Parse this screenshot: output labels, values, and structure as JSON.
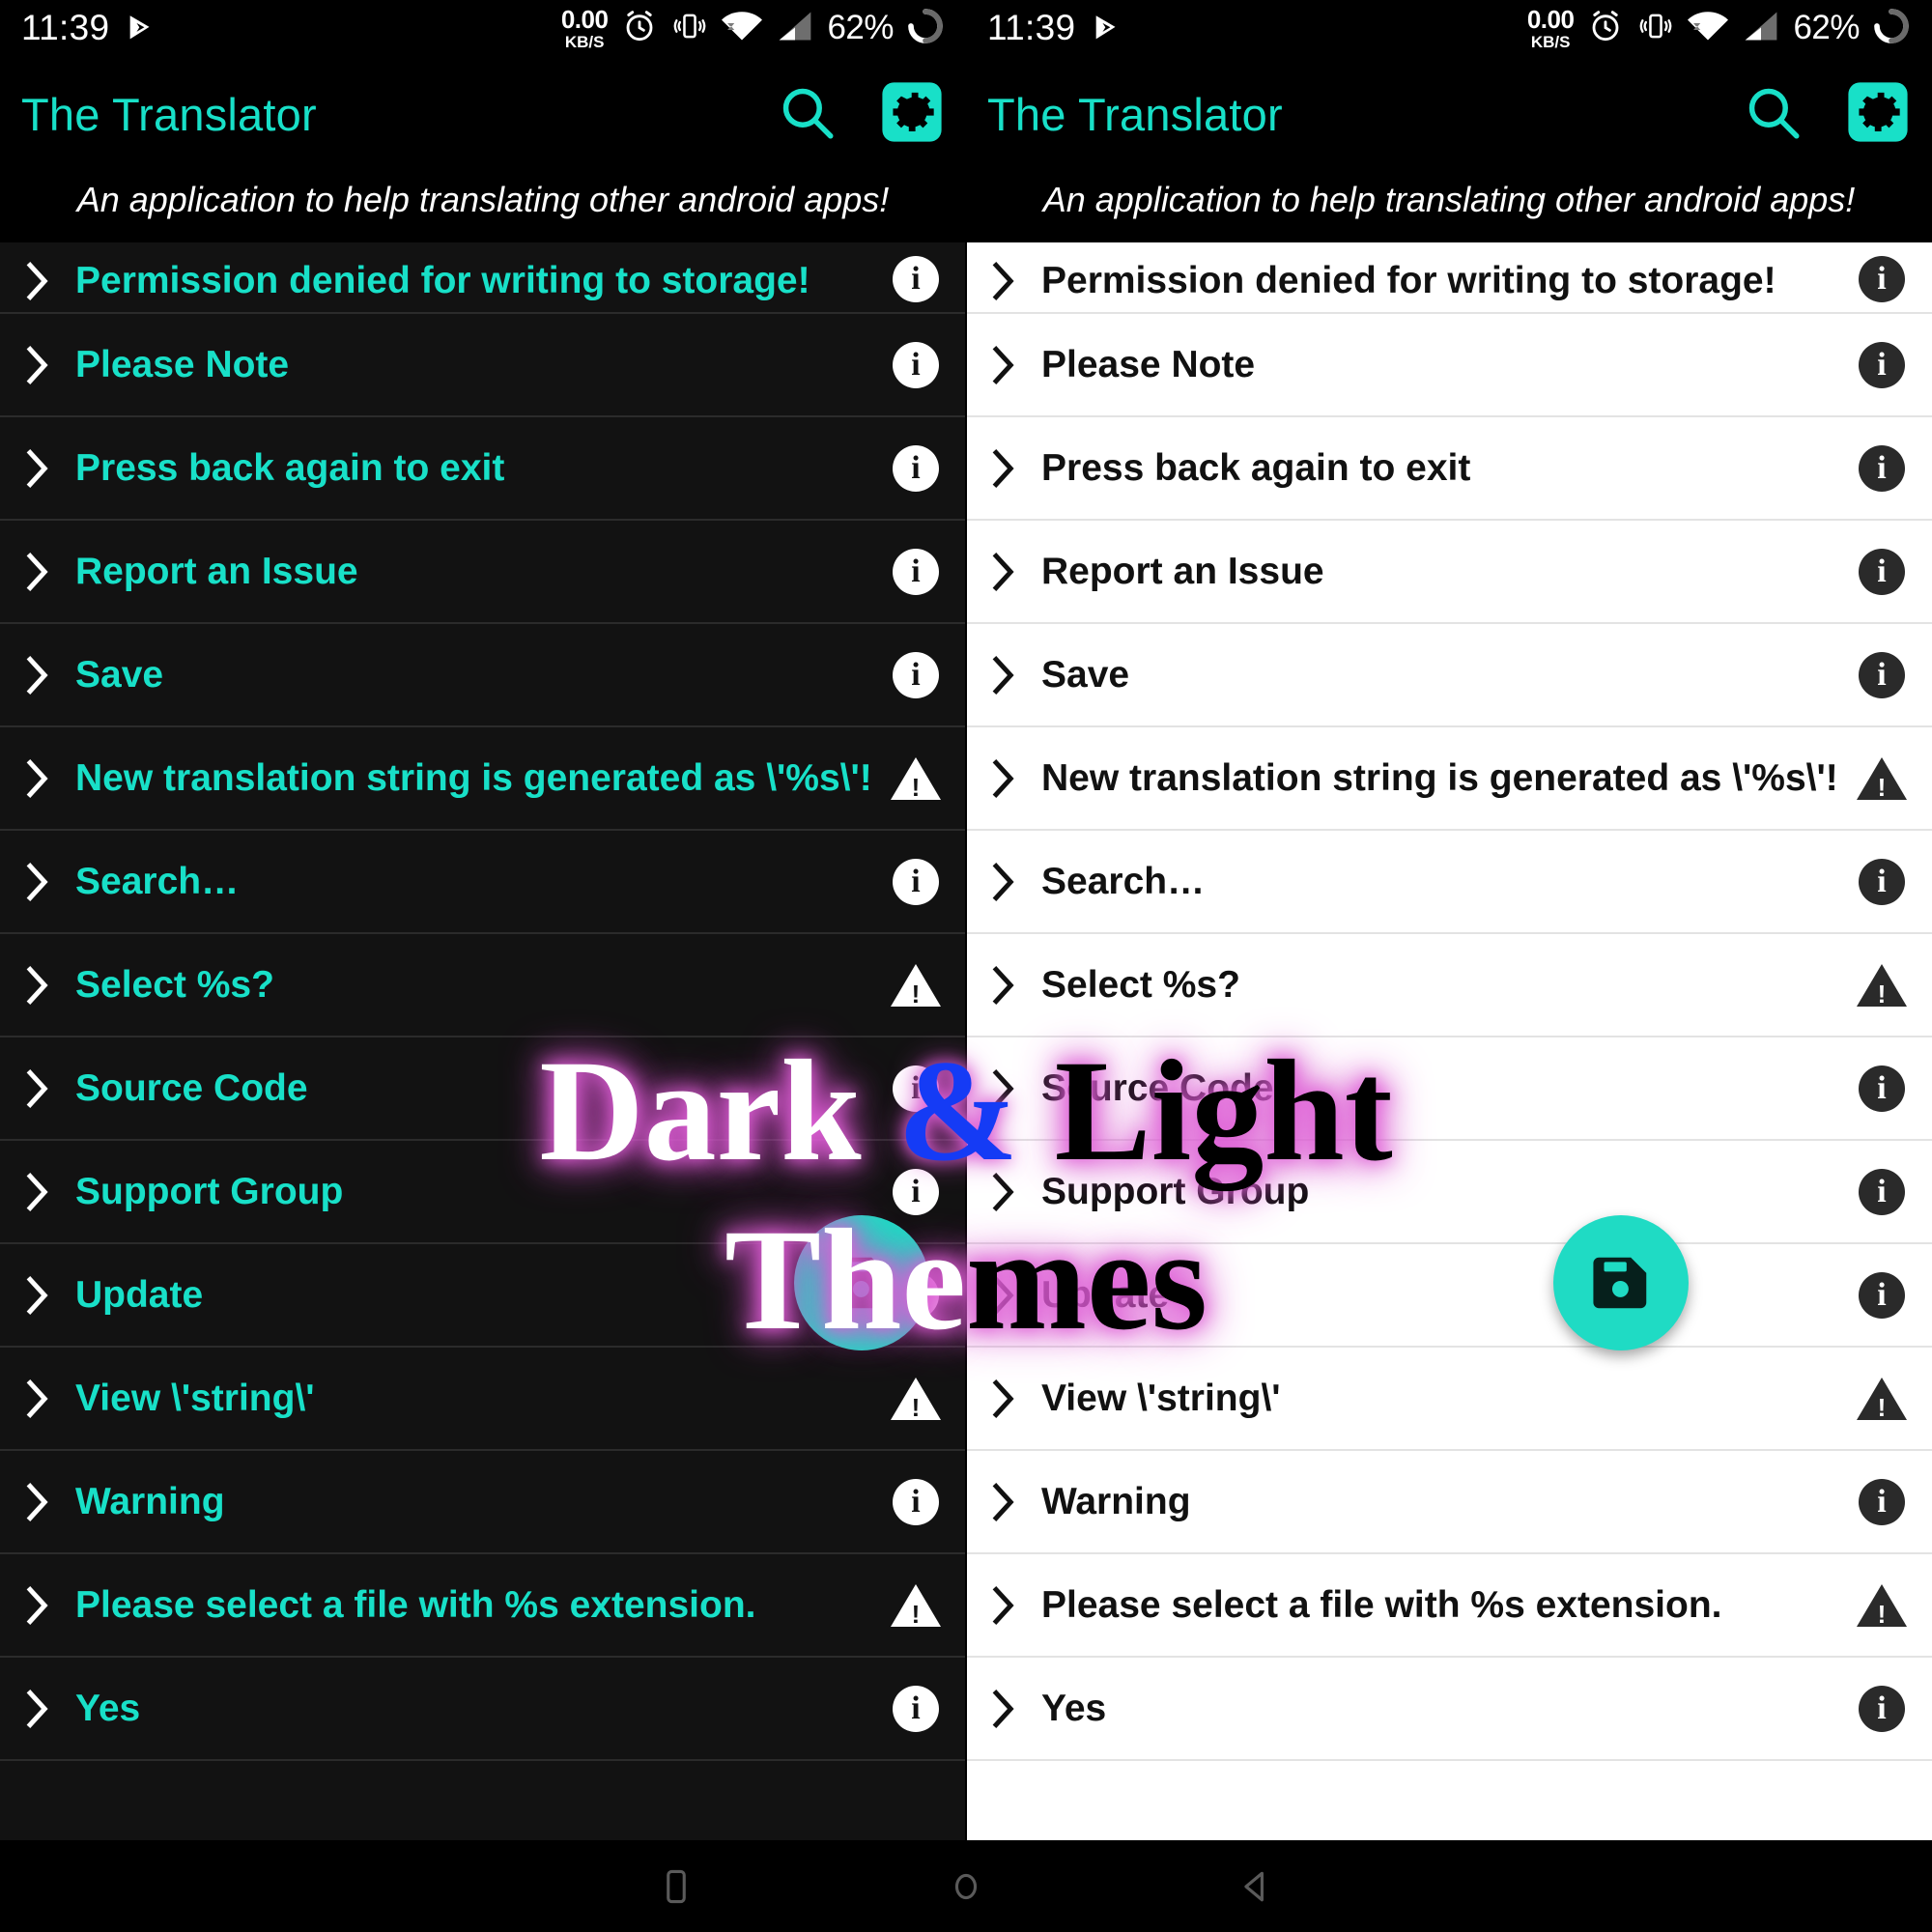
{
  "status_bar": {
    "time": "11:39",
    "network_speed_value": "0.00",
    "network_speed_unit": "KB/S",
    "battery_percent": "62%",
    "icons": [
      "play-store-icon",
      "alarm-icon",
      "vibrate-icon",
      "wifi-icon",
      "signal-icon",
      "battery-icon"
    ]
  },
  "app_bar": {
    "title": "The Translator",
    "search_label": "search-icon",
    "settings_label": "gear-icon",
    "accent_color": "#18e0c8"
  },
  "subtitle": "An application to help translating other android apps!",
  "list_rows": [
    {
      "label": "Permission denied for writing to storage!",
      "icon": "info"
    },
    {
      "label": "Please Note",
      "icon": "info"
    },
    {
      "label": "Press back again to exit",
      "icon": "info"
    },
    {
      "label": "Report an Issue",
      "icon": "info"
    },
    {
      "label": "Save",
      "icon": "info"
    },
    {
      "label": "New translation string is generated as \\'%s\\'!",
      "icon": "warning"
    },
    {
      "label": "Search…",
      "icon": "info"
    },
    {
      "label": "Select %s?",
      "icon": "warning"
    },
    {
      "label": "Source Code",
      "icon": "info"
    },
    {
      "label": "Support Group",
      "icon": "info"
    },
    {
      "label": "Update",
      "icon": "info"
    },
    {
      "label": "View \\'string\\'",
      "icon": "warning"
    },
    {
      "label": "Warning",
      "icon": "info"
    },
    {
      "label": "Please select a file with %s extension.",
      "icon": "warning"
    },
    {
      "label": "Yes",
      "icon": "info"
    }
  ],
  "fab": {
    "name": "save-fab",
    "icon": "floppy-disk-save-icon",
    "color": "#1fdbc4"
  },
  "nav_bar": {
    "recents_label": "recents-square-icon",
    "home_label": "home-circle-icon",
    "back_label": "back-triangle-icon"
  },
  "watermark": {
    "word1": "Dark",
    "amp": "&",
    "word2": "Light",
    "word3": "Themes",
    "glow_color": "#e060d8",
    "amp_color": "#153bf5"
  },
  "themes": {
    "dark_label": "Dark",
    "light_label": "Light"
  }
}
